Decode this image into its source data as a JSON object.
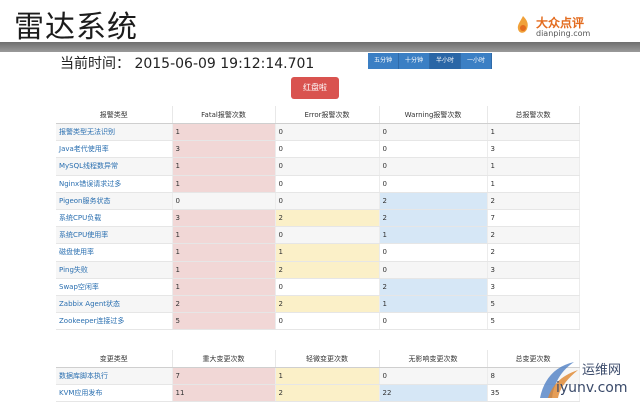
{
  "slide_title": "雷达系统",
  "logo": {
    "cn": "大众点评",
    "en": "dianping.com"
  },
  "time": {
    "label": "当前时间：",
    "value": "2015-06-09 19:12:14.701"
  },
  "ranges": [
    "五分钟",
    "十分钟",
    "半小时",
    "一小时"
  ],
  "active_range": "半小时",
  "red_button": "红盘啦",
  "table1": {
    "headers": [
      "报警类型",
      "Fatal报警次数",
      "Error报警次数",
      "Warning报警次数",
      "总报警次数"
    ],
    "rows": [
      [
        "报警类型无法识别",
        "1",
        "0",
        "0",
        "1"
      ],
      [
        "Java老代使用率",
        "3",
        "0",
        "0",
        "3"
      ],
      [
        "MySQL线程数异常",
        "1",
        "0",
        "0",
        "1"
      ],
      [
        "Nginx错误请求过多",
        "1",
        "0",
        "0",
        "1"
      ],
      [
        "Pigeon服务状态",
        "0",
        "0",
        "2",
        "2"
      ],
      [
        "系统CPU负载",
        "3",
        "2",
        "2",
        "7"
      ],
      [
        "系统CPU使用率",
        "1",
        "0",
        "1",
        "2"
      ],
      [
        "磁盘使用率",
        "1",
        "1",
        "0",
        "2"
      ],
      [
        "Ping失败",
        "1",
        "2",
        "0",
        "3"
      ],
      [
        "Swap空闲率",
        "1",
        "0",
        "2",
        "3"
      ],
      [
        "Zabbix Agent状态",
        "2",
        "2",
        "1",
        "5"
      ],
      [
        "Zookeeper连接过多",
        "5",
        "0",
        "0",
        "5"
      ]
    ]
  },
  "table2": {
    "headers": [
      "变更类型",
      "重大变更次数",
      "轻微变更次数",
      "无影响变更次数",
      "总变更次数"
    ],
    "rows": [
      [
        "数据库脚本执行",
        "7",
        "1",
        "0",
        "8"
      ],
      [
        "KVM应用发布",
        "11",
        "2",
        "22",
        "35"
      ]
    ]
  },
  "colors": {
    "fatal": "#f1d7d6",
    "error": "#fbf0c8",
    "warning": "#d6e7f6",
    "link": "#2a6fb0",
    "button_red": "#d9534f",
    "range_blue": "#3b7fc4"
  },
  "watermark": {
    "cn": "运维网",
    "en": "iyunv.com"
  }
}
